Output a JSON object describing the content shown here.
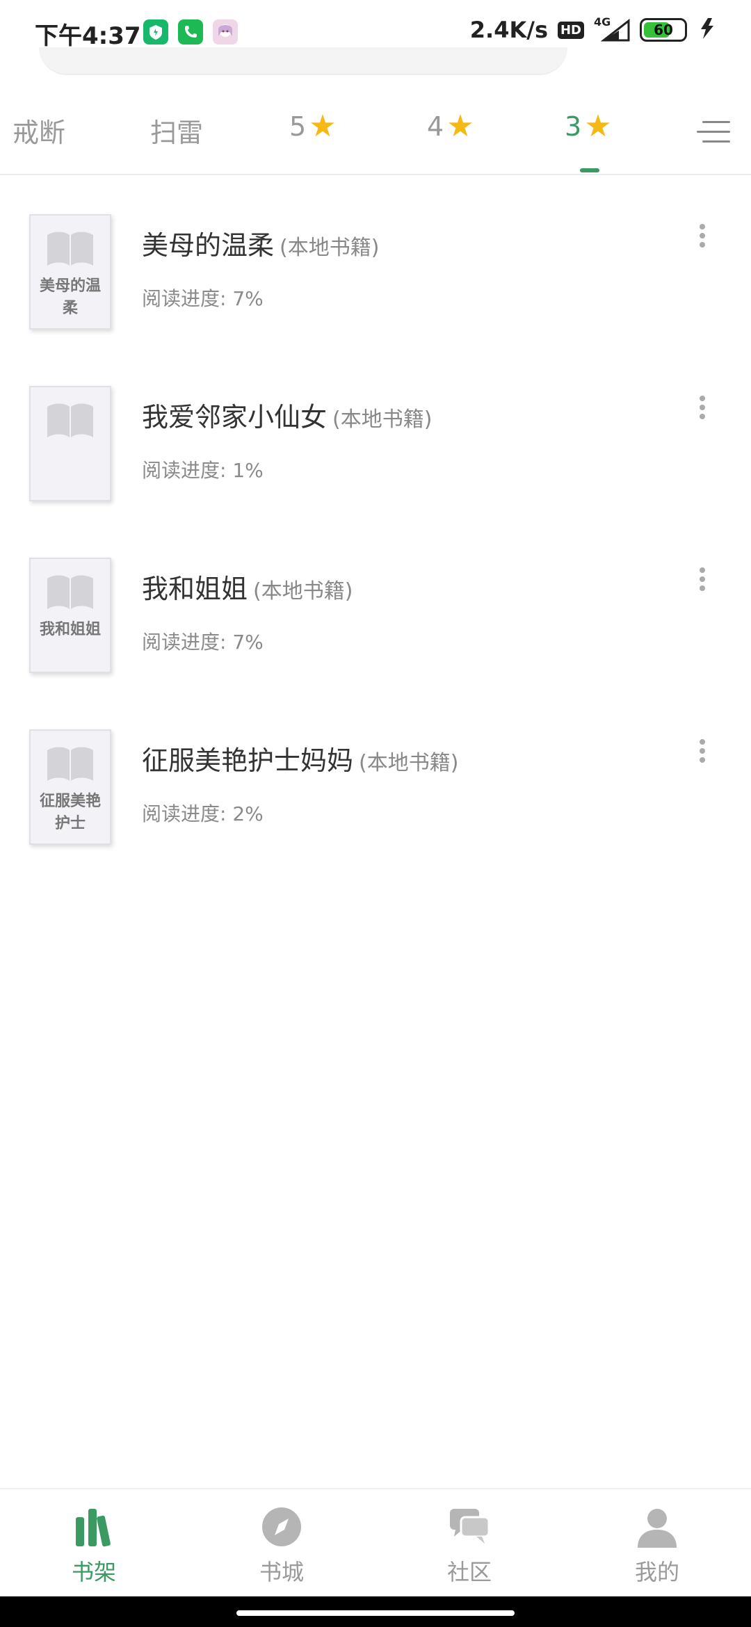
{
  "status_bar": {
    "time": "下午4:37",
    "net_speed": "2.4K/s",
    "hd": "HD",
    "network": "4G",
    "battery": "60",
    "battery_level": 0.6
  },
  "tabs": [
    {
      "label": "戒断",
      "star": false,
      "active": false
    },
    {
      "label": "扫雷",
      "star": false,
      "active": false
    },
    {
      "label": "5",
      "star": true,
      "active": false
    },
    {
      "label": "4",
      "star": true,
      "active": false
    },
    {
      "label": "3",
      "star": true,
      "active": true
    }
  ],
  "books": [
    {
      "title": "美母的温柔",
      "tag": "(本地书籍)",
      "progress": "阅读进度: 7%",
      "cover_text": "美母的温柔"
    },
    {
      "title": "我爱邻家小仙女",
      "tag": "(本地书籍)",
      "progress": "阅读进度: 1%",
      "cover_text": ""
    },
    {
      "title": "我和姐姐",
      "tag": "(本地书籍)",
      "progress": "阅读进度: 7%",
      "cover_text": "我和姐姐"
    },
    {
      "title": "征服美艳护士妈妈",
      "tag": "(本地书籍)",
      "progress": "阅读进度: 2%",
      "cover_text": "征服美艳护士"
    }
  ],
  "bottom_nav": [
    {
      "label": "书架",
      "icon": "bookshelf-icon",
      "active": true
    },
    {
      "label": "书城",
      "icon": "compass-icon",
      "active": false
    },
    {
      "label": "社区",
      "icon": "chat-icon",
      "active": false
    },
    {
      "label": "我的",
      "icon": "person-icon",
      "active": false
    }
  ],
  "colors": {
    "accent": "#3a9a62",
    "star": "#f5b915",
    "text": "#333333",
    "muted": "#8a8a8a"
  }
}
